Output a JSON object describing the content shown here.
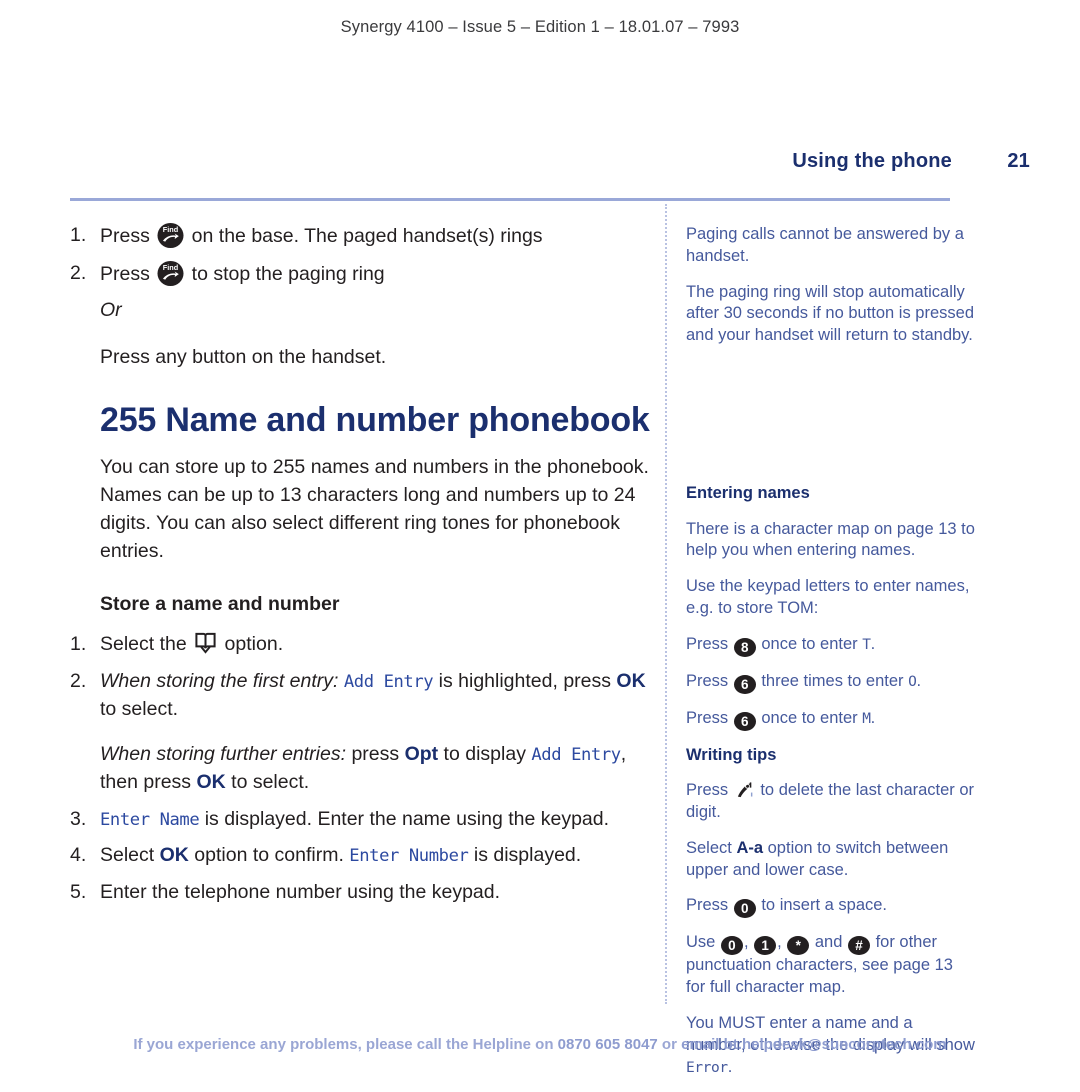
{
  "imprint": "Synergy 4100 – Issue 5 – Edition 1 – 18.01.07 – 7993",
  "runhead": {
    "title": "Using the phone",
    "page": "21"
  },
  "main": {
    "steps_top": [
      {
        "num": "1.",
        "pre": "Press ",
        "icon": "find-button-icon",
        "post": " on the base. The paged handset(s) rings"
      },
      {
        "num": "2.",
        "pre": "Press ",
        "icon": "find-button-icon",
        "post": " to stop the paging ring"
      }
    ],
    "or_label": "Or",
    "or_text": "Press any button on the handset.",
    "chapter_heading": "255 Name and number phonebook",
    "intro": "You can store up to 255 names and numbers in the phonebook. Names can be up to 13 characters long and numbers up to 24 digits. You can also select different ring tones for phonebook entries.",
    "subhead": "Store a name and number",
    "step1": {
      "num": "1.",
      "pre": "Select the ",
      "icon": "phonebook-book-icon",
      "post": " option."
    },
    "step2": {
      "num": "2.",
      "a_italic": "When storing the first entry:",
      "a_lcd": "Add Entry",
      "a_mid": " is highlighted, press ",
      "a_key": "OK",
      "a_end": " to select.",
      "b_italic": "When storing further entries:",
      "b_mid1": " press ",
      "b_key1": "Opt",
      "b_mid2": " to display ",
      "b_lcd": "Add Entry",
      "b_mid3": ", then press ",
      "b_key2": "OK",
      "b_end": " to select."
    },
    "step3": {
      "num": "3.",
      "lcd": "Enter Name",
      "text": " is displayed. Enter the name using the keypad."
    },
    "step4": {
      "num": "4.",
      "pre": "Select ",
      "key": "OK",
      "mid": " option to confirm. ",
      "lcd": "Enter Number",
      "post": " is displayed."
    },
    "step5": {
      "num": "5.",
      "text": "Enter the telephone number using the keypad."
    }
  },
  "side": {
    "note1": "Paging calls cannot be answered by a handset.",
    "note2": "The paging ring will stop automatically after 30 seconds if no button is pressed and your handset will return to standby.",
    "entering_names": {
      "heading": "Entering names",
      "p1": "There is a character map on page 13 to help you when entering names.",
      "p2": "Use the keypad letters to enter names, e.g. to store TOM:",
      "presses": [
        {
          "pre": "Press ",
          "key": "8",
          "mid": " once to enter ",
          "lcd": "T",
          "post": "."
        },
        {
          "pre": "Press ",
          "key": "6",
          "mid": " three times to enter ",
          "lcd": "O",
          "post": "."
        },
        {
          "pre": "Press ",
          "key": "6",
          "mid": " once to enter ",
          "lcd": "M",
          "post": "."
        }
      ]
    },
    "writing_tips": {
      "heading": "Writing tips",
      "p1_pre": "Press ",
      "p1_icon": "delete-key-icon",
      "p1_post": " to delete the last character or digit.",
      "p2_pre": "Select ",
      "p2_key": "A-a",
      "p2_post": " option to switch between upper and lower case.",
      "p3_pre": "Press ",
      "p3_key": "0",
      "p3_post": " to insert a space.",
      "p4_pre": "Use ",
      "p4_keys": [
        "0",
        "1",
        "*",
        "#"
      ],
      "p4_and": " and ",
      "p4_post": " for other punctuation characters, see page 13 for full character map.",
      "p5_pre": "You MUST enter a name and a number, otherwise the display will show ",
      "p5_lcd": "Error",
      "p5_post": "."
    }
  },
  "footer": {
    "pre": "If you experience any problems, please call the Helpline on ",
    "phone": "0870 605 8047",
    "mid": " or ",
    "email": "email bt.helpdesk@suncorptech.com"
  },
  "colors": {
    "heading_navy": "#1b2f6e",
    "side_blue": "#45599c",
    "lcd_blue": "#2c49a0",
    "rule_blue": "#9aa8d8",
    "footer_blue": "#9aa6d4",
    "badge_dark": "#231f20"
  }
}
